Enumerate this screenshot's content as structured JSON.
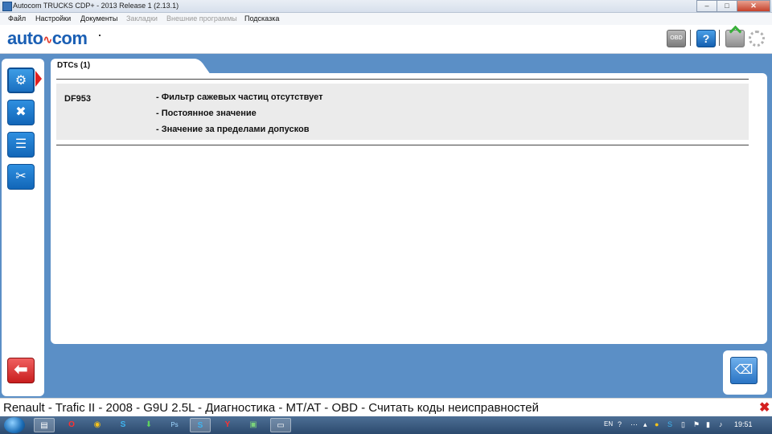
{
  "window": {
    "title": "Autocom TRUCKS CDP+ - 2013 Release 1 (2.13.1)",
    "controls": [
      "–",
      "□",
      "✕"
    ]
  },
  "menu": [
    {
      "label": "Файл",
      "enabled": true
    },
    {
      "label": "Настройки",
      "enabled": true
    },
    {
      "label": "Документы",
      "enabled": true
    },
    {
      "label": "Закладки",
      "enabled": false
    },
    {
      "label": "Внешние программы",
      "enabled": false
    },
    {
      "label": "Подсказка",
      "enabled": true
    }
  ],
  "header": {
    "logo_left": "auto",
    "logo_right": "com",
    "obd_label": "OBD",
    "help_glyph": "?"
  },
  "sidebar": {
    "items": [
      {
        "icon": "engine-icon",
        "active": true
      },
      {
        "icon": "engine-cross-icon",
        "active": false
      },
      {
        "icon": "document-list-icon",
        "active": false
      },
      {
        "icon": "tools-icon",
        "active": false
      }
    ],
    "back_icon": "back-arrow-icon"
  },
  "tab": {
    "label": "DTCs (1)"
  },
  "dtcs": [
    {
      "code": "DF953",
      "descriptions": [
        "- Фильтр сажевых частиц отсутствует",
        "- Постоянное значение",
        "- Значение за пределами допусков"
      ]
    }
  ],
  "status": {
    "text": "Renault - Trafic II - 2008 - G9U 2.5L - Диагностика - MT/AT - OBD - Считать коды неисправностей",
    "close_glyph": "✖"
  },
  "taskbar": {
    "apps": [
      "folder-icon",
      "opera-icon",
      "chrome-icon",
      "skype-icon",
      "download-icon",
      "photoshop-icon",
      "skype-icon",
      "yandex-icon",
      "map-icon",
      "autocom-icon"
    ],
    "lang": "EN",
    "clock": "19:51"
  },
  "colors": {
    "accent_blue": "#5b8fc6",
    "logo_blue": "#1a5fb4",
    "close_red": "#d42020"
  }
}
